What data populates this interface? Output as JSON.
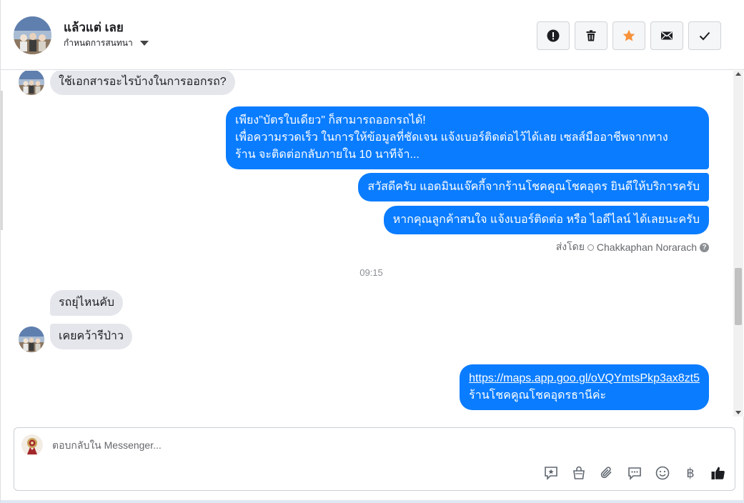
{
  "header": {
    "contact_name": "แล้วแต่ เลย",
    "assign_label": "กำหนดการสนทนา",
    "toolbar": [
      {
        "name": "report-spam-button",
        "icon": "alert-circle-icon"
      },
      {
        "name": "delete-button",
        "icon": "trash-icon"
      },
      {
        "name": "star-button",
        "icon": "star-icon",
        "color": "#f7923b"
      },
      {
        "name": "mark-unread-button",
        "icon": "envelope-icon"
      },
      {
        "name": "mark-done-button",
        "icon": "check-icon"
      }
    ]
  },
  "messages": {
    "incoming_1": "ใช้เอกสารอะไรบ้างในการออกรถ?",
    "outgoing_1": {
      "line1": "เพียง\"บัตรใบเดียว\" ก็สามารถออกรถได้!",
      "line2": "เพื่อความรวดเร็ว ในการให้ข้อมูลที่ชัดเจน แจ้งเบอร์ติดต่อไว้ได้เลย เซลส์มืออาชีพจากทาง",
      "line3": "ร้าน จะติดต่อกลับภายใน 10 นาทีจ้า..."
    },
    "outgoing_2": "สวัสดีครับ แอดมินแจ๊คกี้จากร้านโชคคูณโชคอุดร ยินดีให้บริการครับ",
    "outgoing_3": "หากคุณลูกค้าสนใจ แจ้งเบอร์ติดต่อ หรือ ไอดีไลน์ ได้เลยนะครับ",
    "sent_by_label": "ส่งโดย",
    "sent_by_name": "Chakkaphan Norarach",
    "help_glyph": "?",
    "timestamp": "09:15",
    "incoming_2": "รถยุ่ไหนคับ",
    "incoming_3": "เคยคว้ารีป่าว",
    "outgoing_4": {
      "link": "https://maps.app.goo.gl/oVQYmtsPkp3ax8zt5",
      "text": "ร้านโชคคูณโชคอุดรธานีค่ะ"
    }
  },
  "reply": {
    "placeholder": "ตอบกลับใน Messenger...",
    "tools": [
      "saved-reply-icon",
      "shopping-bag-icon",
      "paperclip-icon",
      "chat-bubble-icon",
      "emoji-icon",
      "baht-icon",
      "thumbs-up-icon"
    ],
    "baht_glyph": "฿"
  },
  "colors": {
    "outgoing_bubble": "#0a7cff",
    "incoming_bubble": "#e4e6eb",
    "star": "#f7923b"
  }
}
